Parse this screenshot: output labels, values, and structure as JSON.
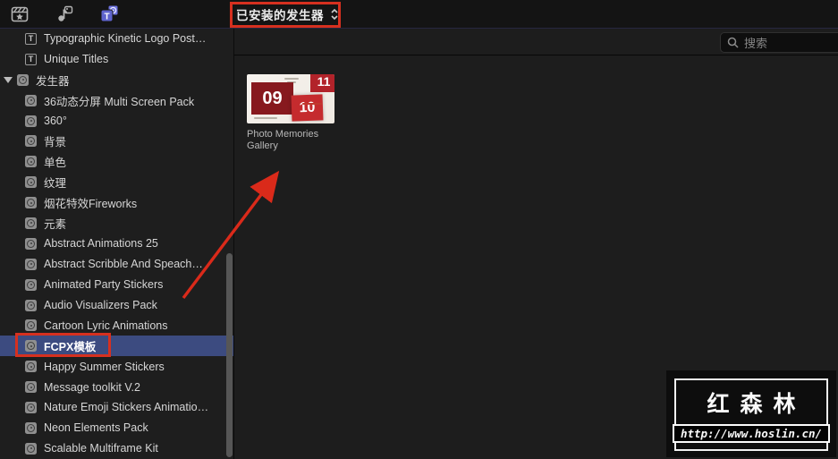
{
  "toolbar": {
    "icons": [
      {
        "name": "effects-browser-icon"
      },
      {
        "name": "photos-audio-browser-icon"
      },
      {
        "name": "titles-generators-browser-icon",
        "active": true
      }
    ],
    "dropdown_label": "已安装的发生器"
  },
  "search": {
    "placeholder": "搜索"
  },
  "sidebar": {
    "items": [
      {
        "label": "Typographic Kinetic Logo Post…",
        "type": "title"
      },
      {
        "label": "Unique Titles",
        "type": "title"
      },
      {
        "label": "发生器",
        "type": "category",
        "expanded": true
      },
      {
        "label": "36动态分屏 Multi Screen Pack",
        "type": "generator"
      },
      {
        "label": "360°",
        "type": "generator"
      },
      {
        "label": "背景",
        "type": "generator"
      },
      {
        "label": "单色",
        "type": "generator"
      },
      {
        "label": "纹理",
        "type": "generator"
      },
      {
        "label": "烟花特效Fireworks",
        "type": "generator"
      },
      {
        "label": "元素",
        "type": "generator"
      },
      {
        "label": "Abstract Animations 25",
        "type": "generator"
      },
      {
        "label": "Abstract Scribble And Speach…",
        "type": "generator"
      },
      {
        "label": "Animated Party Stickers",
        "type": "generator"
      },
      {
        "label": "Audio Visualizers Pack",
        "type": "generator"
      },
      {
        "label": "Cartoon Lyric Animations",
        "type": "generator"
      },
      {
        "label": "FCPX模板",
        "type": "generator",
        "selected": true,
        "annotated": true
      },
      {
        "label": "Happy Summer Stickers",
        "type": "generator"
      },
      {
        "label": "Message toolkit V.2",
        "type": "generator"
      },
      {
        "label": "Nature Emoji Stickers Animatio…",
        "type": "generator"
      },
      {
        "label": "Neon Elements Pack",
        "type": "generator"
      },
      {
        "label": "Scalable Multiframe Kit",
        "type": "generator"
      }
    ]
  },
  "content": {
    "items": [
      {
        "label": "Photo Memories Gallery",
        "thumbnail_numbers": {
          "n1": "09",
          "n2": "10",
          "n3": "11"
        }
      }
    ]
  },
  "watermark": {
    "title": "红森林",
    "url": "http://www.hoslin.cn/"
  },
  "colors": {
    "selection_blue": "#3c4b80",
    "annotation_red": "#d6301f",
    "arrow_red": "#da2a1a",
    "active_icon_blue": "#5f64cd",
    "thumb_dark_red": "#87191e",
    "thumb_bright_red": "#c52b2e"
  }
}
